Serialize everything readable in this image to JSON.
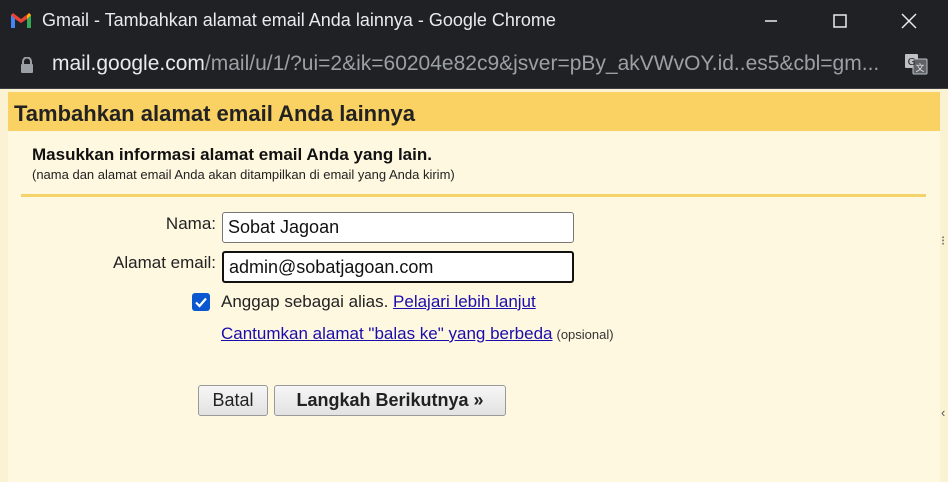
{
  "window": {
    "title": "Gmail - Tambahkan alamat email Anda lainnya - Google Chrome",
    "buttons": [
      "minimize-icon",
      "maximize-icon",
      "close-icon"
    ]
  },
  "addressbar": {
    "host": "mail.google.com",
    "path": "/mail/u/1/?ui=2&ik=60204e82c9&jsver=pBy_akVWvOY.id..es5&cbl=gm..."
  },
  "dialog": {
    "title": "Tambahkan alamat email Anda lainnya",
    "intro_title": "Masukkan informasi alamat email Anda yang lain.",
    "intro_sub": "(nama dan alamat email Anda akan ditampilkan di email yang Anda kirim)",
    "name_label": "Nama:",
    "name_value": "Sobat Jagoan",
    "email_label": "Alamat email:",
    "email_value": "admin@sobatjagoan.com",
    "alias_checked": true,
    "alias_label": "Anggap sebagai alias.",
    "learn_more": "Pelajari lebih lanjut",
    "reply_to_link": "Cantumkan alamat \"balas ke\" yang berbeda",
    "optional": "(opsional)",
    "cancel_label": "Batal",
    "next_label": "Langkah Berikutnya »"
  },
  "colors": {
    "header": "#fad163",
    "content": "#fff8e1",
    "link": "#1a0dab",
    "checkbox": "#0b57d0"
  }
}
